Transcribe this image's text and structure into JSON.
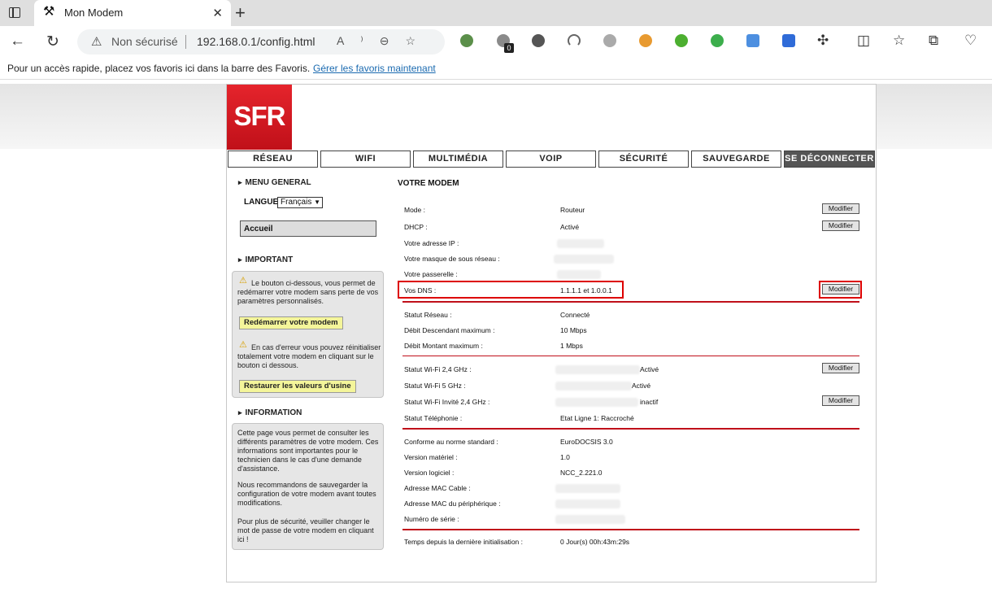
{
  "browser": {
    "tab_title": "Mon Modem",
    "not_secure": "Non sécurisé",
    "url": "192.168.0.1/config.html",
    "favbar_text": "Pour un accès rapide, placez vos favoris ici dans la barre des Favoris.",
    "favbar_link": "Gérer les favoris maintenant",
    "extension_badge": "0"
  },
  "brand": {
    "logo": "SFR"
  },
  "nav": [
    "RÉSEAU",
    "WIFI",
    "MULTIMÉDIA",
    "VOIP",
    "SÉCURITÉ",
    "SAUVEGARDE",
    "SE DÉCONNECTER"
  ],
  "sidebar": {
    "menu_title": "MENU GENERAL",
    "lang_label": "LANGUE",
    "lang_value": "Français",
    "home": "Accueil",
    "important_title": "IMPORTANT",
    "restart_text": "Le bouton ci-dessous, vous permet de redémarrer votre modem sans perte de vos paramètres personnalisés.",
    "restart_button": "Redémarrer votre modem",
    "reset_text": "En cas d'erreur vous pouvez réinitialiser totalement votre modem en cliquant sur le bouton ci dessous.",
    "reset_button": "Restaurer les valeurs d'usine",
    "info_title": "INFORMATION",
    "info_p1": "Cette page vous permet de consulter les différents paramètres de votre modem. Ces informations sont importantes pour le technicien dans le cas d'une demande d'assistance.",
    "info_p2": "Nous recommandons de sauvegarder la configuration de votre modem avant toutes modifications.",
    "info_p3": "Pour plus de sécurité, veuiller changer le mot de passe de votre modem en cliquant ici !"
  },
  "main": {
    "title": "VOTRE MODEM",
    "modify": "Modifier",
    "rows": {
      "mode": {
        "label": "Mode :",
        "value": "Routeur"
      },
      "dhcp": {
        "label": "DHCP :",
        "value": "Activé"
      },
      "ip": {
        "label": "Votre adresse IP :"
      },
      "mask": {
        "label": "Votre masque de sous réseau :"
      },
      "gateway": {
        "label": "Votre passerelle :"
      },
      "dns": {
        "label": "Vos DNS :",
        "value": "1.1.1.1 et 1.0.0.1"
      },
      "net_status": {
        "label": "Statut Réseau :",
        "value": "Connecté"
      },
      "down": {
        "label": "Débit Descendant maximum :",
        "value": "10 Mbps"
      },
      "up": {
        "label": "Débit Montant maximum :",
        "value": "1 Mbps"
      },
      "wifi24": {
        "label": "Statut Wi-Fi 2,4 GHz :",
        "value": "Activé"
      },
      "wifi5": {
        "label": "Statut Wi-Fi 5 GHz :",
        "value": "Activé"
      },
      "wifiguest": {
        "label": "Statut Wi-Fi Invité 2,4 GHz :",
        "value": "inactif"
      },
      "phone": {
        "label": "Statut Téléphonie :",
        "value": "Etat Ligne 1: Raccroché"
      },
      "norm": {
        "label": "Conforme au norme standard :",
        "value": "EuroDOCSIS 3.0"
      },
      "hw": {
        "label": "Version matériel :",
        "value": "1.0"
      },
      "sw": {
        "label": "Version logiciel :",
        "value": "NCC_2.221.0"
      },
      "mac_cable": {
        "label": "Adresse MAC Cable :"
      },
      "mac_dev": {
        "label": "Adresse MAC du périphérique :"
      },
      "serial": {
        "label": "Numéro de série :"
      },
      "uptime": {
        "label": "Temps depuis la dernière initialisation :",
        "value": "0 Jour(s) 00h:43m:29s"
      }
    }
  }
}
